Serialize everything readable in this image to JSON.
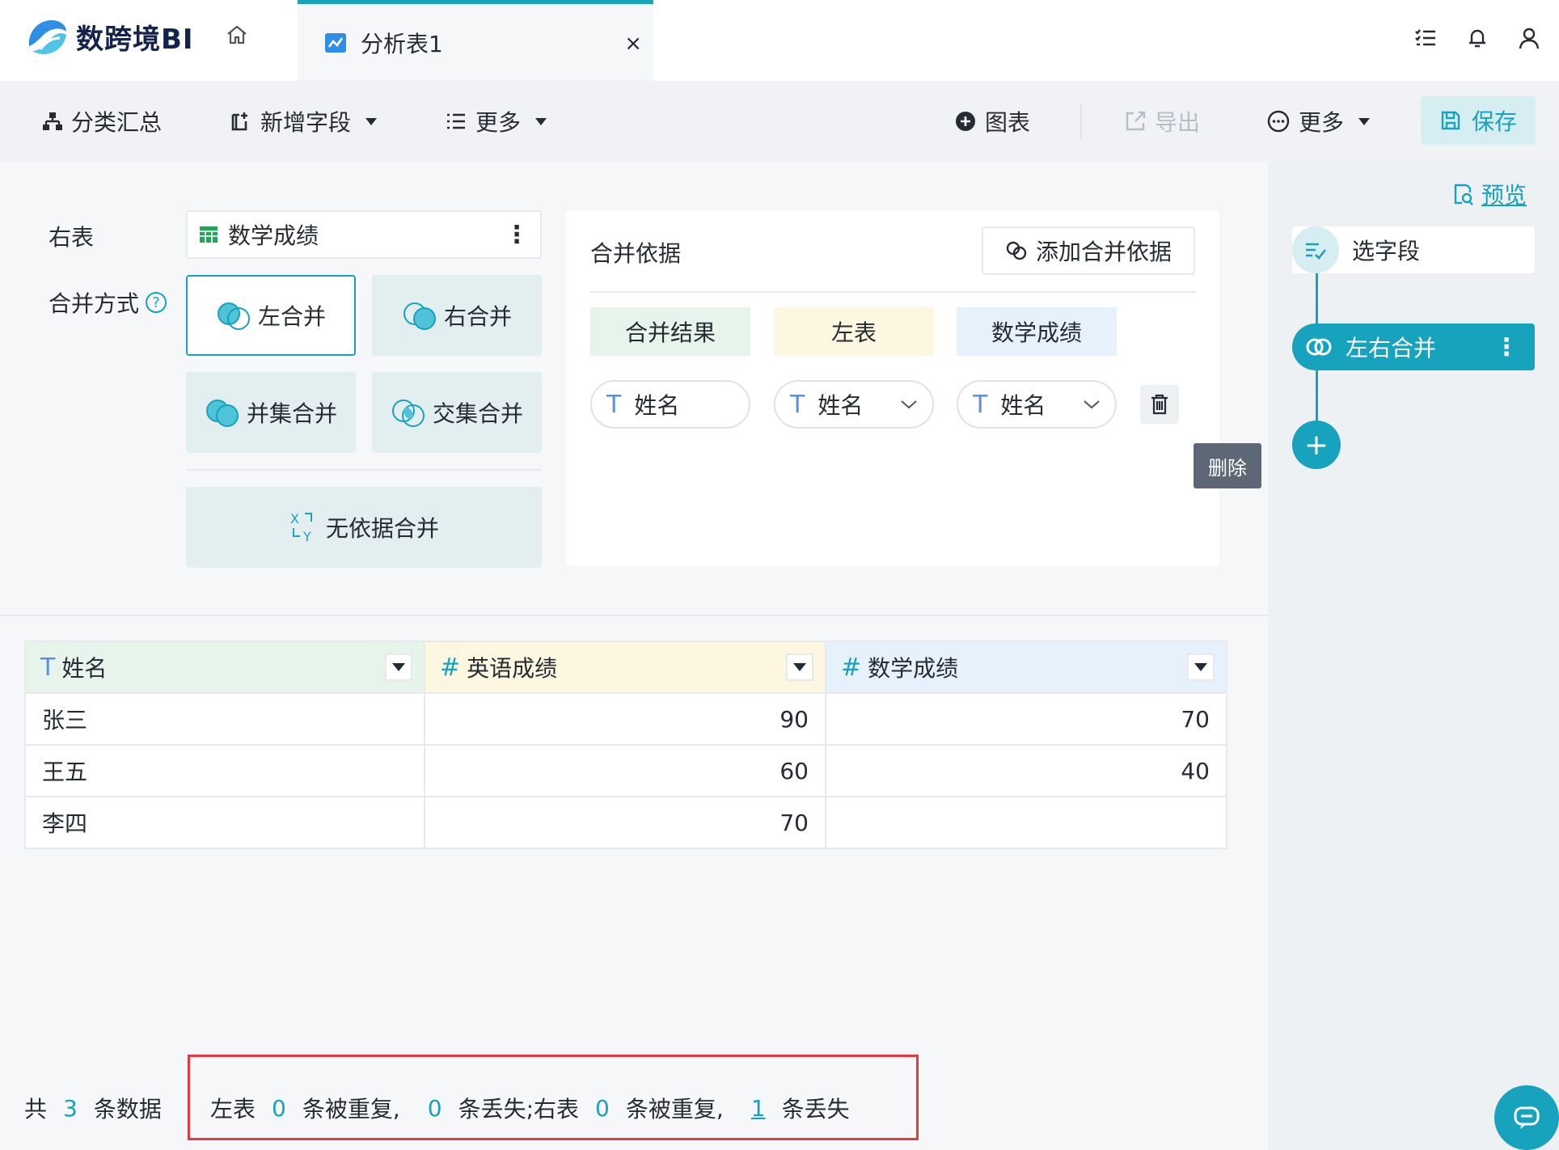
{
  "app": {
    "name": "数跨境BI"
  },
  "tab": {
    "label": "分析表1",
    "close": "×"
  },
  "toolbar": {
    "group_summary": "分类汇总",
    "add_field": "新增字段",
    "more_left": "更多",
    "chart": "图表",
    "export": "导出",
    "more_right": "更多",
    "save": "保存"
  },
  "config": {
    "right_table_label": "右表",
    "right_table_value": "数学成绩",
    "merge_mode_label": "合并方式",
    "help": "?",
    "modes": {
      "left": "左合并",
      "right": "右合并",
      "union": "并集合并",
      "intersect": "交集合并",
      "none": "无依据合并"
    },
    "selected_mode": "左合并"
  },
  "merge_basis": {
    "title": "合并依据",
    "add_button": "添加合并依据",
    "headers": {
      "result": "合并结果",
      "left": "左表",
      "right": "数学成绩"
    },
    "fields": {
      "result": "姓名",
      "left": "姓名",
      "right": "姓名"
    },
    "type_glyph": "T",
    "delete_tooltip": "删除"
  },
  "table": {
    "columns": [
      {
        "type": "T",
        "name": "姓名"
      },
      {
        "type": "#",
        "name": "英语成绩"
      },
      {
        "type": "#",
        "name": "数学成绩"
      }
    ],
    "rows": [
      [
        "张三",
        "90",
        "70"
      ],
      [
        "王五",
        "60",
        "40"
      ],
      [
        "李四",
        "70",
        ""
      ]
    ]
  },
  "footer": {
    "total_prefix": "共",
    "total": "3",
    "total_suffix": "条数据",
    "left_prefix": "左表",
    "left_dup": "0",
    "dup_text": "条被重复,",
    "left_lost": "0",
    "lost_text_semi": "条丢失;",
    "right_prefix": "右表",
    "right_dup": "0",
    "dup_text2": "条被重复,",
    "right_lost": "1",
    "lost_text": "条丢失"
  },
  "pipeline": {
    "preview": "预览",
    "step1": "选字段",
    "step2": "左右合并",
    "add": "+"
  },
  "colors": {
    "accent": "#17a2bd",
    "result_chip": "#e6f4ec",
    "left_chip": "#fdf6e0",
    "right_chip": "#e6f1fb",
    "alert": "#e5383f"
  }
}
